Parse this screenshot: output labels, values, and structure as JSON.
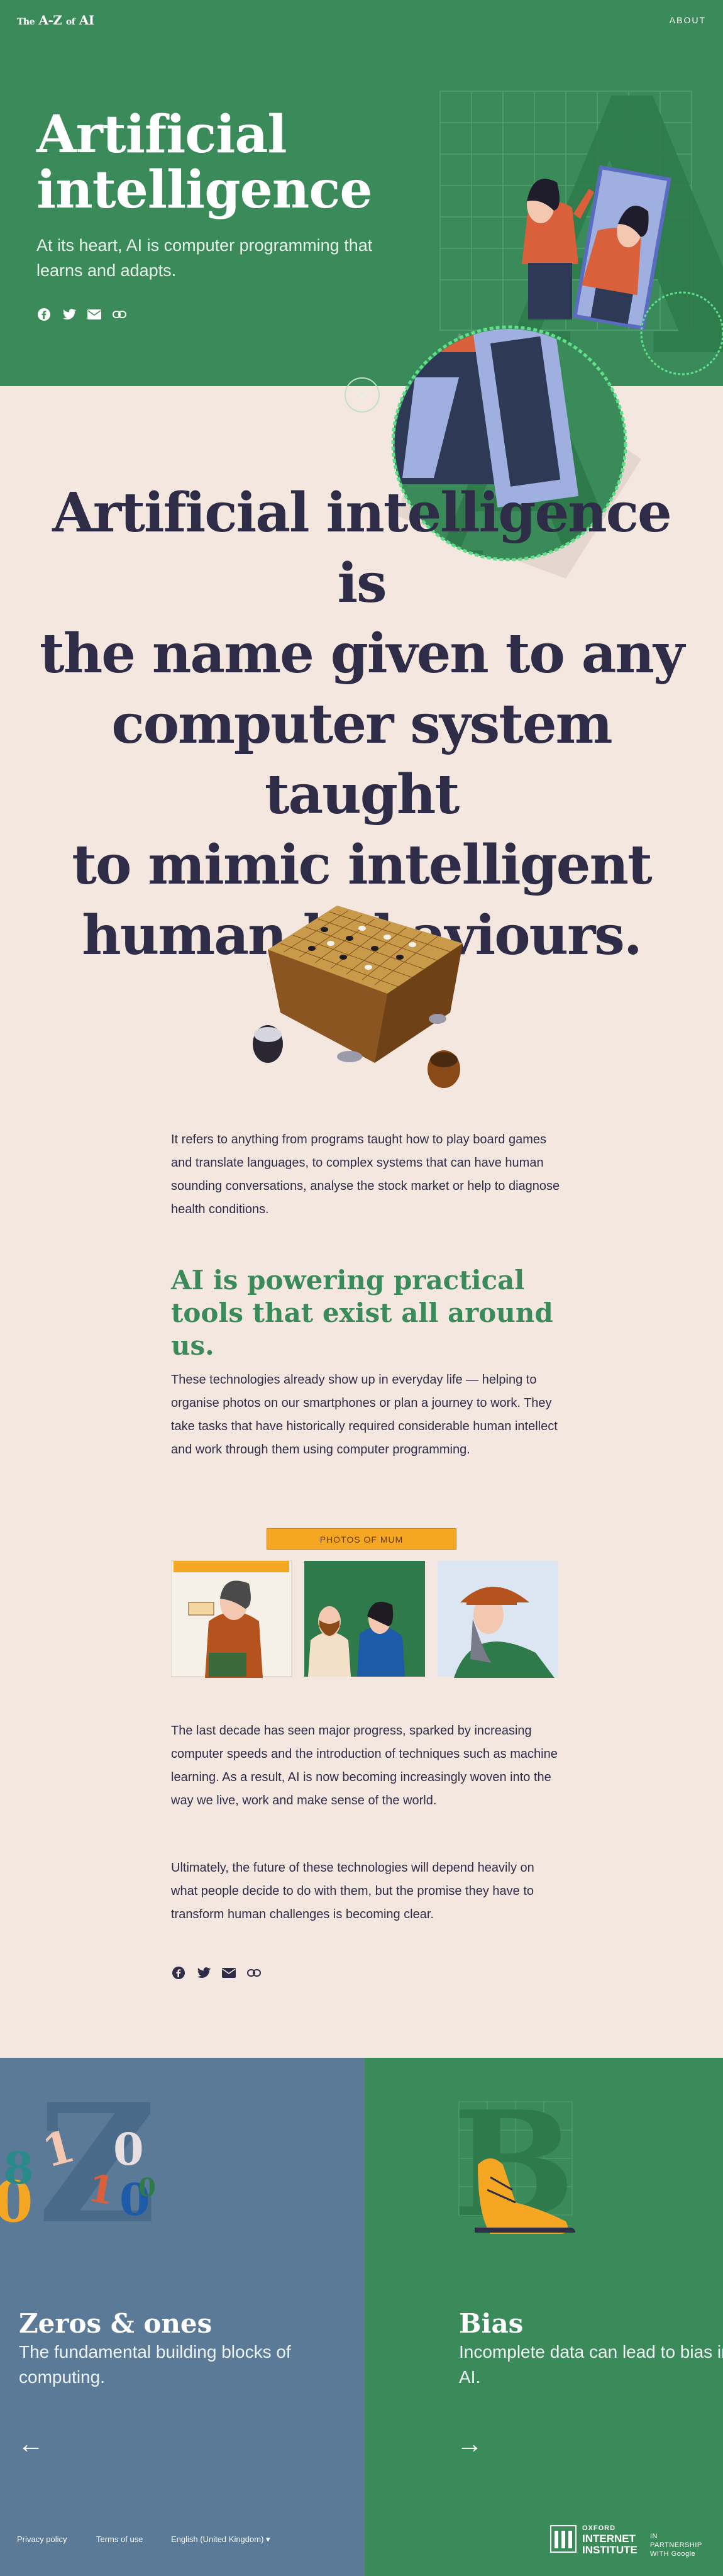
{
  "header": {
    "logo_prefix": "The",
    "logo_main": "A-Z",
    "logo_of": "of",
    "logo_ai": "AI",
    "about_label": "ABOUT"
  },
  "hero": {
    "title_line1": "Artificial",
    "title_line2": "intelligence",
    "subtitle": "At its heart, AI is computer programming that learns and adapts.",
    "share_icons": [
      "facebook-icon",
      "twitter-icon",
      "email-icon",
      "link-icon"
    ]
  },
  "quote": {
    "line1": "Artificial intelligence is",
    "line2": "the name given to any",
    "line3": "computer system taught",
    "line4": "to mimic intelligent",
    "line5": "human behaviours."
  },
  "article": {
    "para1": "It refers to anything from programs taught how to play board games and translate languages, to complex systems that can have human sounding conversations, analyse the stock market or help to diagnose health conditions.",
    "heading": "AI is powering practical tools that exist all around us.",
    "para2": "These technologies already show up in everyday life — helping to organise photos on our smartphones or plan a journey to work. They take tasks that have historically required considerable human intellect and work through them using computer programming.",
    "photos_label": "PHOTOS OF MUM",
    "para3": "The last decade has seen major progress, sparked by increasing computer speeds and the introduction of techniques such as machine learning. As a result, AI is now becoming increasingly woven into the way we live, work and make sense of the world.",
    "para4": "Ultimately, the future of these technologies will depend heavily on what people decide to do with them, but the promise they have to transform human challenges is becoming clear."
  },
  "cards": {
    "prev": {
      "title": "Zeros & ones",
      "subtitle": "The fundamental building blocks of computing.",
      "arrow": "←"
    },
    "next": {
      "title": "Bias",
      "subtitle": "Incomplete data can lead to bias in AI.",
      "arrow": "→"
    }
  },
  "footer": {
    "privacy": "Privacy policy",
    "terms": "Terms of use",
    "language": "English (United Kingdom)",
    "oii_line1": "OXFORD",
    "oii_line2": "INTERNET",
    "oii_line3": "INSTITUTE",
    "partner_line1": "IN PARTNERSHIP",
    "partner_line2": "WITH Google"
  },
  "colors": {
    "green": "#3a8a5a",
    "cream": "#f4e7e0",
    "navy": "#2e2c47",
    "slate_blue": "#5a7a98",
    "orange": "#f5a623"
  }
}
